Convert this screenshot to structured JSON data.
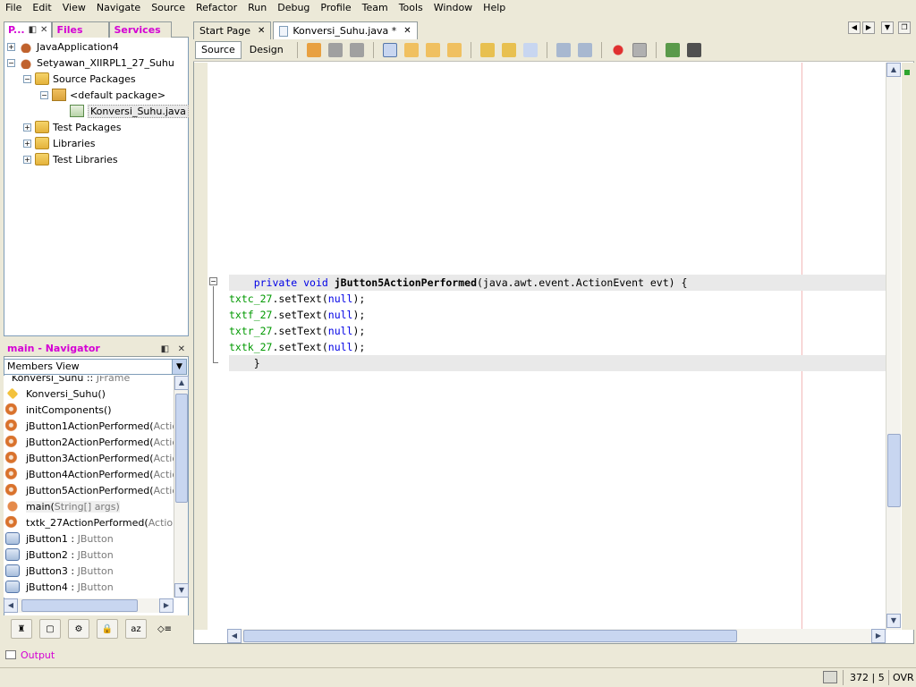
{
  "menu": [
    "File",
    "Edit",
    "View",
    "Navigate",
    "Source",
    "Refactor",
    "Run",
    "Debug",
    "Profile",
    "Team",
    "Tools",
    "Window",
    "Help"
  ],
  "left_tabs": {
    "projects": "P...",
    "files": "Files",
    "services": "Services"
  },
  "project_tree": [
    {
      "label": "JavaApplication4",
      "icon": "coffee-cup-icon",
      "expander": "+"
    },
    {
      "label": "Setyawan_XIIRPL1_27_Suhu",
      "icon": "coffee-cup-icon",
      "expander": "−"
    },
    {
      "label": "Source Packages",
      "icon": "folder-icon",
      "expander": "−"
    },
    {
      "label": "<default package>",
      "icon": "package-icon",
      "expander": "−"
    },
    {
      "label": "Konversi_Suhu.java",
      "icon": "java-file-icon",
      "expander": ""
    },
    {
      "label": "Test Packages",
      "icon": "folder-icon",
      "expander": "+"
    },
    {
      "label": "Libraries",
      "icon": "folder-icon",
      "expander": "+"
    },
    {
      "label": "Test Libraries",
      "icon": "folder-icon",
      "expander": "+"
    }
  ],
  "navigator": {
    "title": "main - Navigator",
    "view_select": "Members View",
    "members": [
      {
        "name": "Konversi_Suhu :: ",
        "type": "JFrame",
        "kind": "class"
      },
      {
        "name": "Konversi_Suhu()",
        "type": "",
        "kind": "ctor"
      },
      {
        "name": "initComponents()",
        "type": "",
        "kind": "method"
      },
      {
        "name": "jButton1ActionPerformed(",
        "type": "ActionEv",
        "kind": "method"
      },
      {
        "name": "jButton2ActionPerformed(",
        "type": "ActionEv",
        "kind": "method"
      },
      {
        "name": "jButton3ActionPerformed(",
        "type": "ActionEv",
        "kind": "method"
      },
      {
        "name": "jButton4ActionPerformed(",
        "type": "ActionEv",
        "kind": "method"
      },
      {
        "name": "jButton5ActionPerformed(",
        "type": "ActionEv",
        "kind": "method"
      },
      {
        "name": "main(",
        "type": "String[] args)",
        "kind": "static"
      },
      {
        "name": "txtk_27ActionPerformed(",
        "type": "ActionEve",
        "kind": "method"
      },
      {
        "name": "jButton1 : ",
        "type": "JButton",
        "kind": "field"
      },
      {
        "name": "jButton2 : ",
        "type": "JButton",
        "kind": "field"
      },
      {
        "name": "jButton3 : ",
        "type": "JButton",
        "kind": "field"
      },
      {
        "name": "jButton4 : ",
        "type": "JButton",
        "kind": "field"
      }
    ]
  },
  "editor_tabs": [
    {
      "label": "Start Page",
      "active": false
    },
    {
      "label": "Konversi_Suhu.java *",
      "active": true
    }
  ],
  "editor_views": {
    "source": "Source",
    "design": "Design"
  },
  "code": {
    "line1": {
      "indent": "    ",
      "kw1": "private",
      "kw2": "void",
      "method": "jButton5ActionPerformed",
      "params": "(java.awt.event.ActionEvent evt) {"
    },
    "lines": [
      {
        "field": "txtc_27",
        "call": ".setText(",
        "arg": "null",
        "end": ");"
      },
      {
        "field": "txtf_27",
        "call": ".setText(",
        "arg": "null",
        "end": ");"
      },
      {
        "field": "txtr_27",
        "call": ".setText(",
        "arg": "null",
        "end": ");"
      },
      {
        "field": "txtk_27",
        "call": ".setText(",
        "arg": "null",
        "end": ");"
      }
    ],
    "closing": "    }"
  },
  "output_label": "Output",
  "status": {
    "position": "372 | 5",
    "mode": "OVR"
  }
}
